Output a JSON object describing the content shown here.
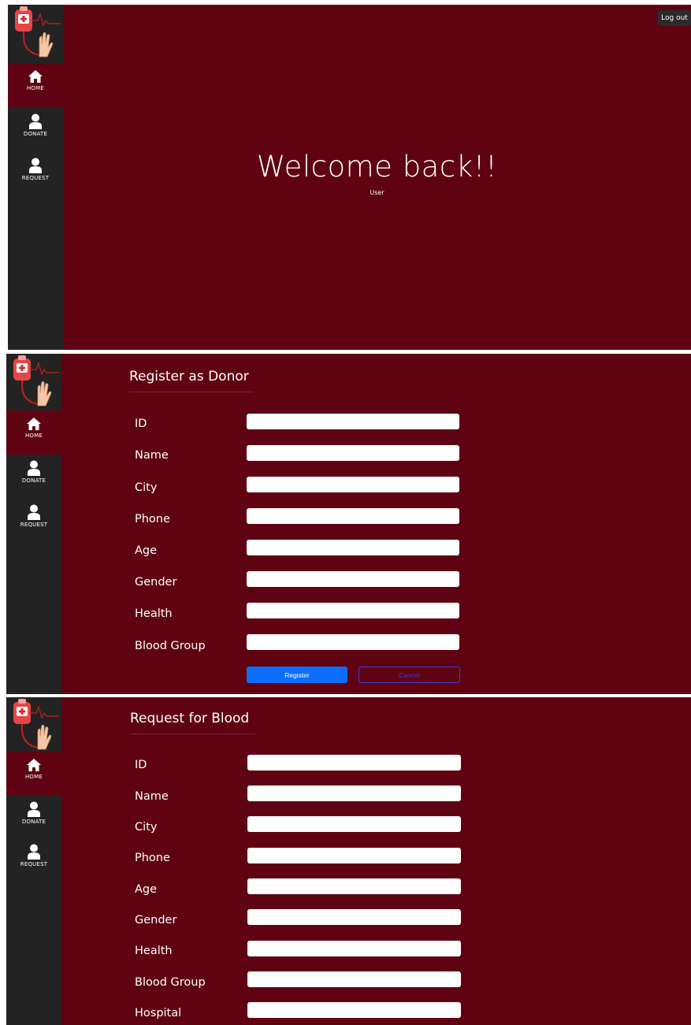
{
  "nav": {
    "home": "HOME",
    "donate": "DONATE",
    "request": "REQUEST"
  },
  "welcome": {
    "logout": "Log out",
    "title": "Welcome back!!",
    "subtitle": "User"
  },
  "donor_form": {
    "title": "Register as Donor",
    "fields": {
      "id": "ID",
      "name": "Name",
      "city": "City",
      "phone": "Phone",
      "age": "Age",
      "gender": "Gender",
      "health": "Health",
      "blood_group": "Blood Group"
    },
    "register_label": "Register",
    "cancel_label": "Cancel"
  },
  "request_form": {
    "title": "Request for Blood",
    "fields": {
      "id": "ID",
      "name": "Name",
      "city": "City",
      "phone": "Phone",
      "age": "Age",
      "gender": "Gender",
      "health": "Health",
      "blood_group": "Blood Group",
      "hospital": "Hospital"
    }
  },
  "colors": {
    "background": "#5f0312",
    "sidebar": "#232323",
    "primary_button": "#0d6efd"
  }
}
